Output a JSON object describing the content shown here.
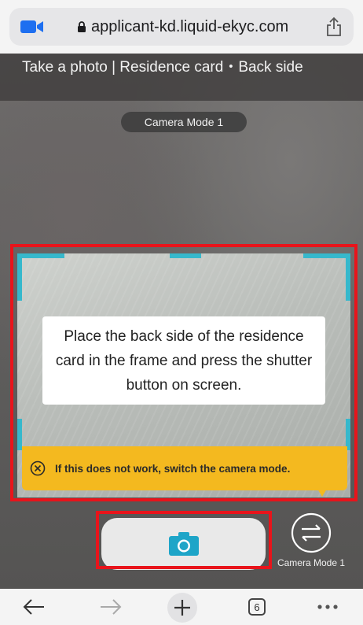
{
  "browser": {
    "url": "applicant-kd.liquid-ekyc.com",
    "tab_count": "6"
  },
  "camera_page": {
    "title": "Take a photo | Residence card・Back side",
    "mode_pill": "Camera Mode 1",
    "instruction": "Place the back side of the residence card in the frame and press the shutter button on screen.",
    "warning": "If this does not work, switch the camera mode.",
    "switch_label": "Camera Mode 1"
  },
  "icons": {
    "app": "video-camera-icon",
    "lock": "lock-icon",
    "share": "share-icon",
    "warning": "close-circle-icon",
    "shutter": "camera-icon",
    "switch": "swap-arrows-icon",
    "back": "arrow-left-icon",
    "forward": "arrow-right-icon",
    "new_tab": "plus-icon",
    "more": "more-dots-icon"
  },
  "colors": {
    "accent": "#36b8cc",
    "warning_bg": "#f4b91f",
    "highlight": "#e8141b"
  }
}
